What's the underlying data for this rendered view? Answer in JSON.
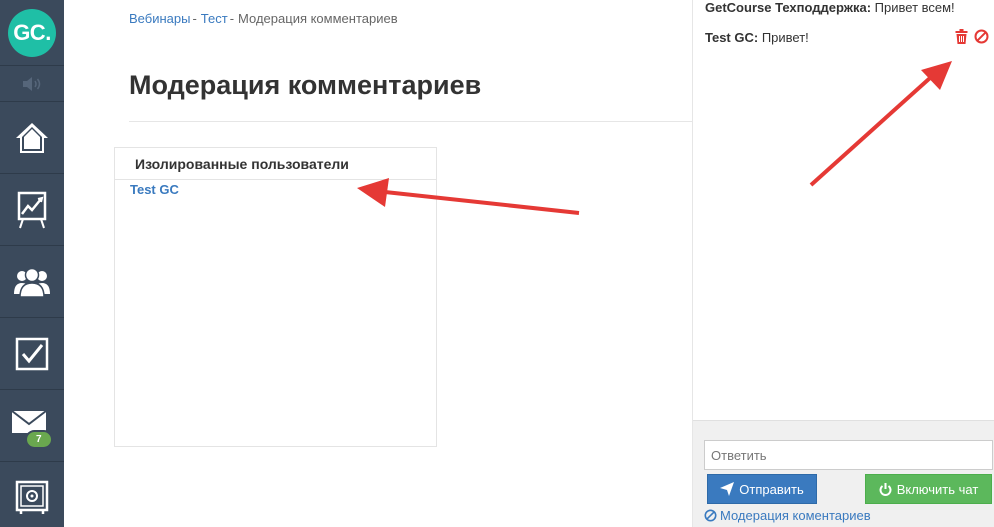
{
  "sidebar": {
    "logo": "GC.",
    "mail_badge": "7",
    "icons": [
      "home-icon",
      "stats-icon",
      "users-icon",
      "tasks-icon",
      "mail-icon",
      "safe-icon"
    ]
  },
  "breadcrumb": {
    "items": [
      "Вебинары",
      "Тест"
    ],
    "separator": "-",
    "current": "Модерация комментариев"
  },
  "page": {
    "title": "Модерация комментариев"
  },
  "isolated_panel": {
    "header": "Изолированные пользователи",
    "users": [
      "Test GC"
    ]
  },
  "chat": {
    "messages": [
      {
        "author": "GetCourse Техподдержка:",
        "text": " Привет всем!"
      },
      {
        "author": "Test GC:",
        "text": " Привет!"
      }
    ],
    "reply_placeholder": "Ответить",
    "send_label": "Отправить",
    "enable_chat_label": "Включить чат",
    "moderation_link": "Модерация коментариев"
  },
  "colors": {
    "sidebar": "#3b4a5c",
    "logo": "#1fbfa6",
    "link": "#3a7abf",
    "send": "#3a7abf",
    "enable": "#5cb85c",
    "danger": "#e53935",
    "arrow": "#e53935"
  }
}
